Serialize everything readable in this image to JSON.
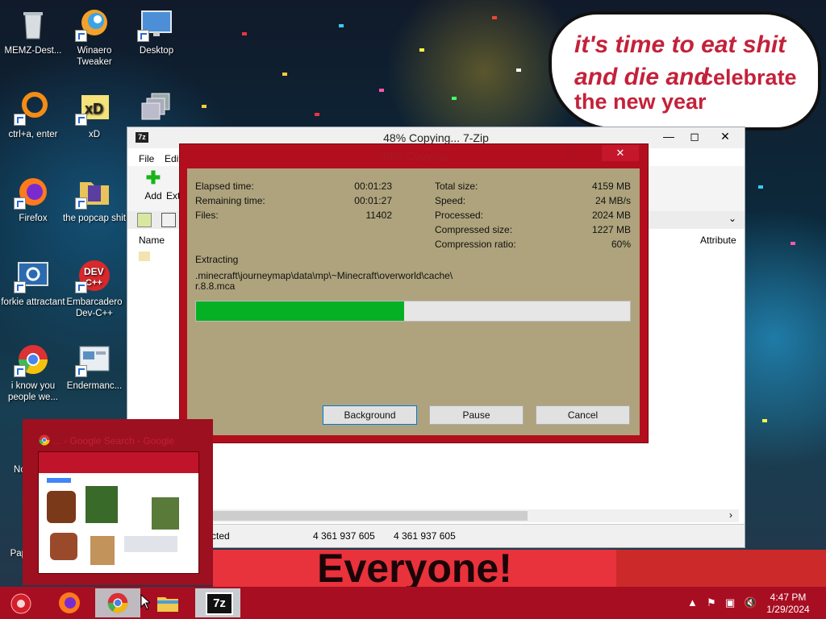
{
  "desktop": {
    "icons": [
      {
        "label": "MEMZ-Dest...",
        "icon": "recycle-bin-icon"
      },
      {
        "label": "Winaero Tweaker",
        "icon": "winaero-icon"
      },
      {
        "label": "Desktop",
        "icon": "monitor-icon"
      },
      {
        "label": "ctrl+a, enter",
        "icon": "orange-ring-icon"
      },
      {
        "label": "xD",
        "icon": "hxd-icon"
      },
      {
        "label": "Firefox",
        "icon": "firefox-icon"
      },
      {
        "label": "the popcap shit",
        "icon": "folder-icon"
      },
      {
        "label": "forkie attractant",
        "icon": "settings-monitor-icon"
      },
      {
        "label": "Embarcadero Dev-C++",
        "icon": "devcpp-icon"
      },
      {
        "label": "i know you people we...",
        "icon": "chrome-icon"
      },
      {
        "label": "Endermanc...",
        "icon": "window-icon"
      },
      {
        "label": "Not",
        "icon": "app-icon"
      },
      {
        "label": "Pape",
        "icon": "app-icon"
      }
    ],
    "bubble": {
      "line1": "it's time to eat shit",
      "line2": "and die and",
      "line2b": "celebrate",
      "line3": "the new year"
    },
    "banner": "Everyone!"
  },
  "main_window": {
    "title": "48% Copying... 7-Zip",
    "app_icon": "7z",
    "menu": [
      "File",
      "Edit"
    ],
    "toolbar": {
      "add": "Add",
      "extract": "Ext"
    },
    "columns": {
      "name": "Name",
      "attributes": "Attribute"
    },
    "status": {
      "selected": "cted",
      "size1": "4 361 937 605",
      "size2": "4 361 937 605"
    }
  },
  "progress_dialog": {
    "title": "48% Copying",
    "close": "✕",
    "stats_left": [
      {
        "label": "Elapsed time:",
        "value": "00:01:23"
      },
      {
        "label": "Remaining time:",
        "value": "00:01:27"
      },
      {
        "label": "Files:",
        "value": "11402"
      }
    ],
    "stats_right": [
      {
        "label": "Total size:",
        "value": "4159 MB"
      },
      {
        "label": "Speed:",
        "value": "24 MB/s"
      },
      {
        "label": "Processed:",
        "value": "2024 MB"
      },
      {
        "label": "Compressed size:",
        "value": "1227 MB"
      },
      {
        "label": "Compression ratio:",
        "value": "60%"
      }
    ],
    "operation": "Extracting",
    "path_line1": ".minecraft\\journeymap\\data\\mp\\~Minecraft\\overworld\\cache\\",
    "path_line2": "r.8.8.mca",
    "progress_percent": 48,
    "buttons": {
      "background": "Background",
      "pause": "Pause",
      "cancel": "Cancel"
    }
  },
  "chrome_thumbnail": {
    "title": "... - Google Search - Google"
  },
  "taskbar": {
    "time": "4:47 PM",
    "date": "1/29/2024",
    "apps": [
      "start-orb-icon",
      "firefox-icon",
      "chrome-icon",
      "file-explorer-icon",
      "7zip-icon"
    ],
    "zip_label": "7z"
  },
  "colors": {
    "taskbar": "#a80e22",
    "dialog_frame": "#b30e1e",
    "dialog_body": "#aea37c",
    "progress_fill": "#06b025"
  }
}
